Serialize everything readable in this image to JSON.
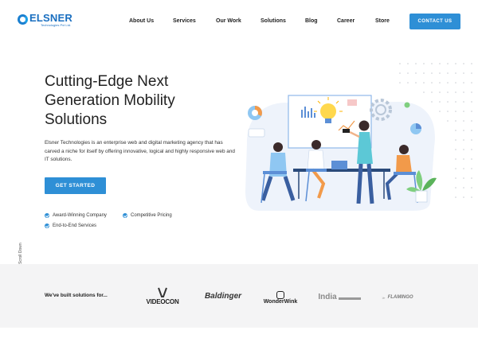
{
  "header": {
    "logo_name": "ELSNER",
    "logo_sub": "Technologies Pvt Ltd.",
    "nav": [
      "About Us",
      "Services",
      "Our Work",
      "Solutions",
      "Blog",
      "Career",
      "Store"
    ],
    "contact_label": "CONTACT US"
  },
  "hero": {
    "title_line1": "Cutting-Edge Next",
    "title_line2": "Generation Mobility",
    "title_line3": "Solutions",
    "description": "Elsner Technologies is an enterprise web and digital marketing agency that has carved a niche for itself by offering innovative, logical and highly responsive web and IT solutions.",
    "cta_label": "GET STARTED",
    "features": [
      "Award-Winning Company",
      "Competitive Pricing",
      "End-to-End Services"
    ]
  },
  "scroll_label": "Scroll Down",
  "clients": {
    "label": "We've built solutions for...",
    "logos": [
      "VIDEOCON",
      "Baldinger",
      "WonderWink",
      "India",
      "FLAMINGO"
    ]
  },
  "colors": {
    "accent": "#2e8fd6",
    "logo_blue": "#1a6fc0",
    "band_bg": "#f4f4f5"
  }
}
